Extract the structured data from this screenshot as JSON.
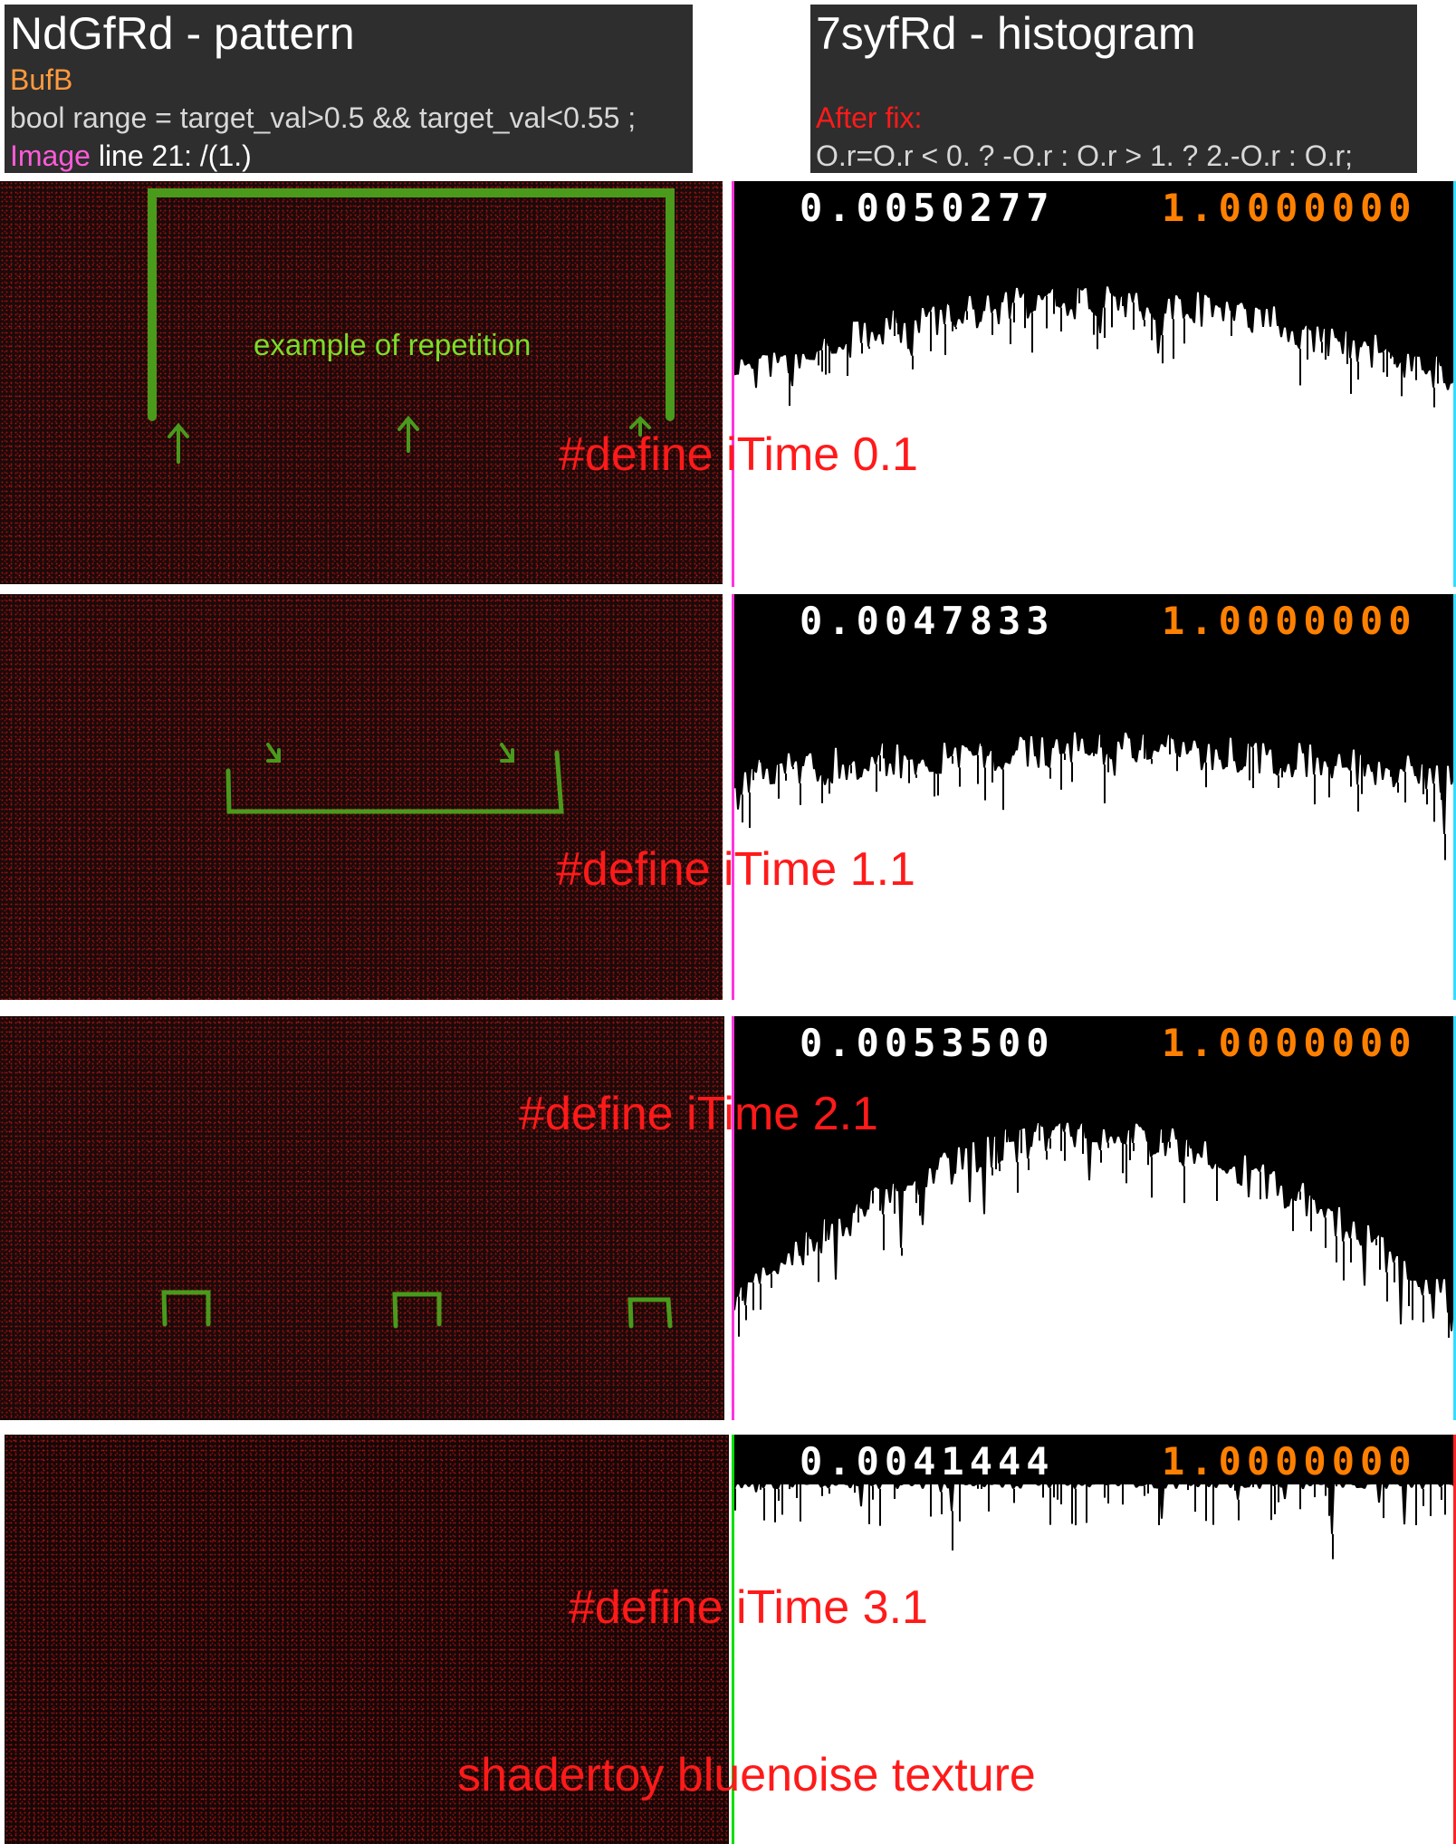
{
  "left_header": {
    "title": "NdGfRd - pattern",
    "buffer_label": "BufB",
    "code_line": "bool range = target_val>0.5 && target_val<0.55 ;",
    "image_label": "Image",
    "image_line": " line 21: /(1.)"
  },
  "right_header": {
    "title": "7syfRd - histogram",
    "fix_label": "After fix:",
    "fix_code": "O.r=O.r < 0. ? -O.r : O.r > 1. ? 2.-O.r : O.r;"
  },
  "annotations": {
    "repetition_label": "example of repetition"
  },
  "rows": [
    {
      "label": "#define iTime 0.1",
      "hist_min": "0.0050277",
      "hist_max": "1.0000000",
      "left_edge_color": "#ff33dd",
      "right_edge_color": "#33ddff",
      "hist_shape": "arch",
      "hist_top_fraction": 0.35,
      "hist_bottom_fraction": 0.13
    },
    {
      "label": "#define iTime 1.1",
      "hist_min": "0.0047833",
      "hist_max": "1.0000000",
      "left_edge_color": "#ff33dd",
      "right_edge_color": "#33ddff",
      "hist_shape": "flat-arch",
      "hist_top_fraction": 0.22,
      "hist_bottom_fraction": 0.25
    },
    {
      "label": "#define iTime 2.1",
      "hist_min": "0.0053500",
      "hist_max": "1.0000000",
      "left_edge_color": "#ff33dd",
      "right_edge_color": "#33ddff",
      "hist_shape": "arch",
      "hist_top_fraction": 0.75,
      "hist_bottom_fraction": 0.3
    },
    {
      "label": "#define iTime 3.1",
      "hist_min": "0.0041444",
      "hist_max": "1.0000000",
      "left_edge_color": "#00dd00",
      "right_edge_color": "#ff2222",
      "hist_shape": "flat",
      "hist_top_fraction": 0.1,
      "hist_bottom_fraction": 0.1,
      "caption": "shadertoy bluenoise texture"
    }
  ]
}
